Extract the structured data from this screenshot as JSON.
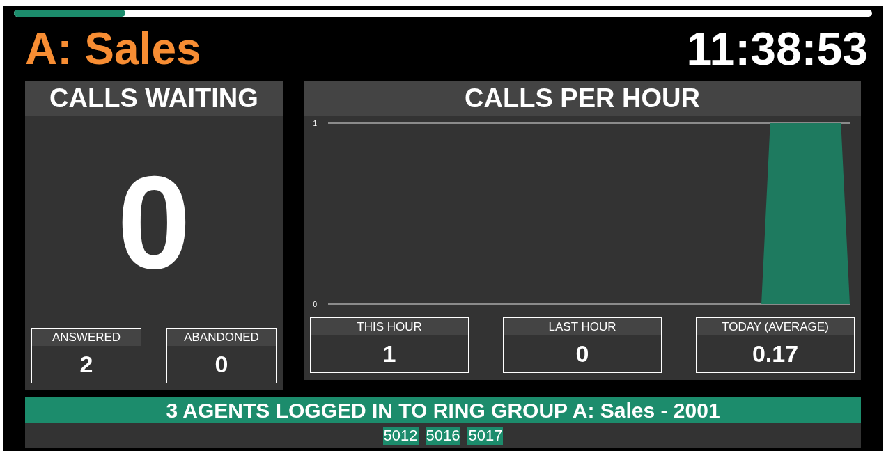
{
  "progress": {
    "level": 0.13
  },
  "header": {
    "title": "A: Sales",
    "clock": "11:38:53"
  },
  "calls_waiting": {
    "title": "CALLS WAITING",
    "count": "0",
    "stats": [
      {
        "label": "ANSWERED",
        "value": "2"
      },
      {
        "label": "ABANDONED",
        "value": "0"
      }
    ]
  },
  "calls_per_hour": {
    "title": "CALLS PER HOUR",
    "chart_data": {
      "type": "area",
      "categories": [
        null,
        null,
        null,
        null,
        null,
        null,
        null,
        null,
        null,
        null,
        null,
        null,
        null,
        null,
        null,
        null,
        null,
        null,
        null,
        null,
        null,
        null,
        null,
        null,
        null,
        null,
        null,
        null,
        null,
        null,
        null,
        null,
        null,
        null,
        null,
        null,
        null,
        null,
        null,
        null,
        null,
        null,
        null,
        null,
        null,
        null,
        null,
        null,
        null,
        null,
        null,
        null,
        null,
        null,
        null,
        null,
        null,
        null,
        null,
        null
      ],
      "ylim": [
        0,
        1
      ],
      "yticks": [
        0,
        1
      ],
      "series": [
        {
          "color": "#1e7a5f",
          "values": [
            0,
            0,
            0,
            0,
            0,
            0,
            0,
            0,
            0,
            0,
            0,
            0,
            0,
            0,
            0,
            0,
            0,
            0,
            0,
            0,
            0,
            0,
            0,
            0,
            0,
            0,
            0,
            0,
            0,
            0,
            0,
            0,
            0,
            0,
            0,
            0,
            0,
            0,
            0,
            0,
            0,
            0,
            0,
            0,
            0,
            0,
            0,
            0,
            0,
            0,
            1,
            1,
            1,
            1,
            1,
            1,
            1,
            1,
            1,
            0
          ]
        }
      ]
    },
    "stats": [
      {
        "label": "THIS HOUR",
        "value": "1"
      },
      {
        "label": "LAST HOUR",
        "value": "0"
      },
      {
        "label": "TODAY (AVERAGE)",
        "value": "0.17"
      }
    ]
  },
  "agents": {
    "banner": "3 AGENTS LOGGED IN TO RING GROUP A: Sales - 2001",
    "extensions": [
      "5012",
      "5016",
      "5017"
    ]
  }
}
